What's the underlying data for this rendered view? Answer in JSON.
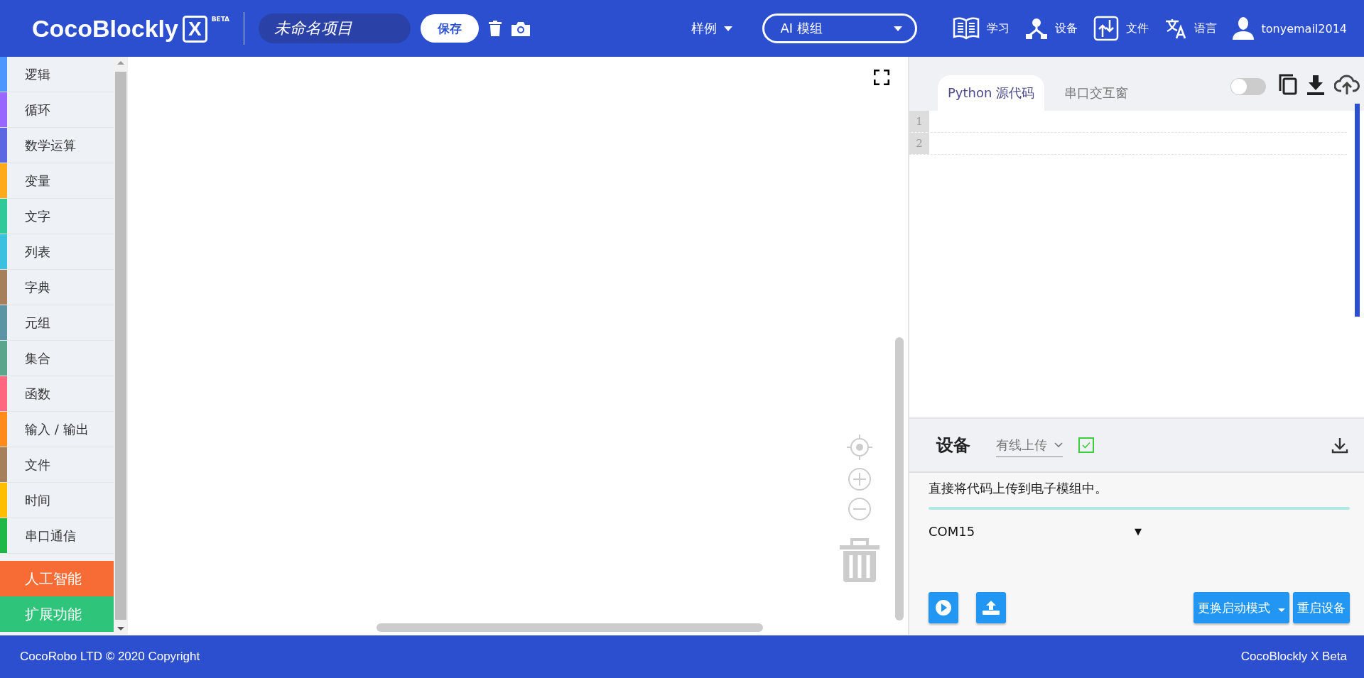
{
  "header": {
    "logo": "CocoBlockly",
    "logo_mark": "X",
    "beta": "BETA",
    "project_name": "未命名项目",
    "save": "保存",
    "examples": "样例",
    "module_select": "AI 模组",
    "nav": [
      {
        "kind": "book",
        "label": "学习"
      },
      {
        "kind": "device",
        "label": "设备"
      },
      {
        "kind": "file",
        "label": "文件"
      },
      {
        "kind": "lang",
        "label": "语言"
      },
      {
        "kind": "user",
        "label": "tonyemail2014"
      }
    ]
  },
  "sidebar": {
    "categories": [
      {
        "label": "逻辑",
        "color": "#4c97ff"
      },
      {
        "label": "循环",
        "color": "#9966ff"
      },
      {
        "label": "数学运算",
        "color": "#5c68e2"
      },
      {
        "label": "变量",
        "color": "#ffab19"
      },
      {
        "label": "文字",
        "color": "#2fc99a"
      },
      {
        "label": "列表",
        "color": "#3cc0e0"
      },
      {
        "label": "字典",
        "color": "#a5805b"
      },
      {
        "label": "元组",
        "color": "#5b94a5"
      },
      {
        "label": "集合",
        "color": "#5ba58c"
      },
      {
        "label": "函数",
        "color": "#ff6680"
      },
      {
        "label": "输入 / 输出",
        "color": "#ff8c1a"
      },
      {
        "label": "文件",
        "color": "#a5805b"
      },
      {
        "label": "时间",
        "color": "#ffbf00"
      },
      {
        "label": "串口通信",
        "color": "#1fb847"
      }
    ],
    "extras": [
      {
        "label": "人工智能",
        "color": "#f76b35"
      },
      {
        "label": "扩展功能",
        "color": "#2ec47a"
      }
    ]
  },
  "code_panel": {
    "tabs": [
      {
        "label": "Python 源代码",
        "selected": true
      },
      {
        "label": "串口交互窗",
        "selected": false
      }
    ],
    "toggle_on": false,
    "line_numbers": [
      "1",
      "2"
    ]
  },
  "device_panel": {
    "title": "设备",
    "upload_mode": "有线上传",
    "checked": true,
    "description": "直接将代码上传到电子模组中。",
    "port": "COM15",
    "port_arrow": "▼",
    "mode_button": "更换启动模式",
    "restart_button": "重启设备"
  },
  "footer": {
    "left": "CocoRobo LTD © 2020 Copyright",
    "right": "CocoBlockly X Beta"
  }
}
